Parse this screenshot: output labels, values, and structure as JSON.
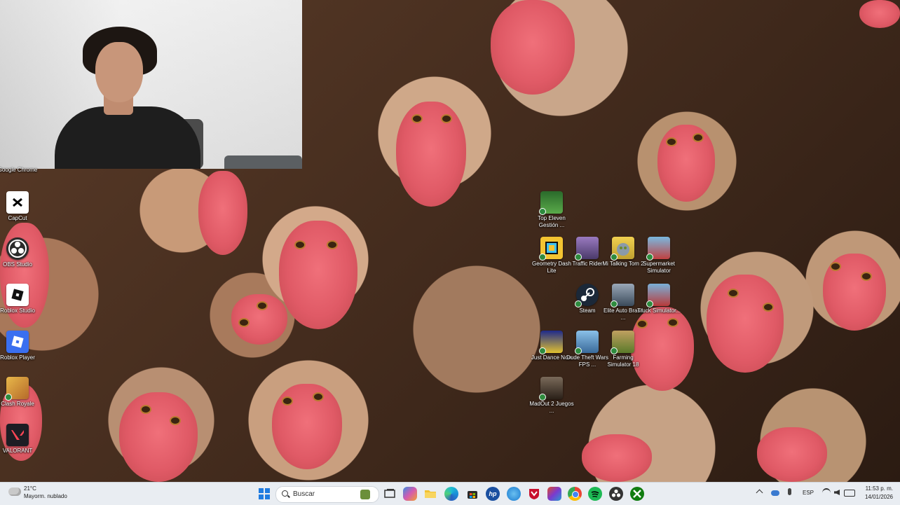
{
  "webcam": {
    "label": ""
  },
  "desktop_left": [
    {
      "label": "Google Chrome",
      "icon": "chrome-icon",
      "color": "#ffffff"
    },
    {
      "label": "CapCut",
      "icon": "capcut-icon",
      "color": "#ffffff"
    },
    {
      "label": "OBS Studio",
      "icon": "obs-icon",
      "color": "#2b2b2b"
    },
    {
      "label": "Roblox Studio",
      "icon": "roblox-studio-icon",
      "color": "#ffffff"
    },
    {
      "label": "Roblox Player",
      "icon": "roblox-player-icon",
      "color": "#3a6ff0"
    },
    {
      "label": "Clash Royale",
      "icon": "clash-royale-icon",
      "color": "#d8a13a"
    },
    {
      "label": "VALORANT",
      "icon": "valorant-icon",
      "color": "#1d1d24"
    }
  ],
  "desktop_games": [
    {
      "label": "Top Eleven Gestión ...",
      "icon": "top-eleven-icon",
      "color": "#3d8f3a"
    },
    {
      "label": "Geometry Dash Lite",
      "icon": "geometry-dash-icon",
      "color": "#f4c431"
    },
    {
      "label": "Traffic Rider",
      "icon": "traffic-rider-icon",
      "color": "#7a5a9a"
    },
    {
      "label": "Mi Talking Tom 2",
      "icon": "talking-tom-icon",
      "color": "#e9c341"
    },
    {
      "label": "Supermarket Simulator",
      "icon": "supermarket-simulator-icon",
      "color": "#5fa4d6"
    },
    {
      "label": "Steam",
      "icon": "steam-icon",
      "color": "#1b2838"
    },
    {
      "label": "Elite Auto Brasil ...",
      "icon": "elite-auto-icon",
      "color": "#6b7a8a"
    },
    {
      "label": "Truck Simulator...",
      "icon": "truck-simulator-icon",
      "color": "#b83a3a"
    },
    {
      "label": "Just Dance Now",
      "icon": "just-dance-icon",
      "color": "#1f2a8a"
    },
    {
      "label": "Dude Theft Wars FPS ...",
      "icon": "dude-theft-wars-icon",
      "color": "#5a9ad0"
    },
    {
      "label": "Farming Simulator 18",
      "icon": "farming-simulator-icon",
      "color": "#8a6a2a"
    },
    {
      "label": "MadOut 2 Juegos ...",
      "icon": "madout-icon",
      "color": "#4a3a2a"
    }
  ],
  "taskbar": {
    "weather_temp": "21°C",
    "weather_desc": "Mayorm. nublado",
    "search_placeholder": "Buscar",
    "apps": [
      {
        "icon": "windows-start-icon",
        "color": "#1e7be0"
      },
      {
        "icon": "widgets-icon",
        "color": "#6b8f3a"
      },
      {
        "icon": "task-view-icon",
        "color": "#3a3a3a"
      },
      {
        "icon": "copilot-icon",
        "color": "#7d5de0"
      },
      {
        "icon": "file-explorer-icon",
        "color": "#f2c230"
      },
      {
        "icon": "edge-icon",
        "color": "#1a8fd8"
      },
      {
        "icon": "store-icon",
        "color": "#2a2a2a"
      },
      {
        "icon": "hp-icon",
        "color": "#1a4fa0"
      },
      {
        "icon": "browser-icon",
        "color": "#2a8ad0"
      },
      {
        "icon": "mcafee-icon",
        "color": "#c8102e"
      },
      {
        "icon": "office-icon",
        "color": "#d04a2a"
      },
      {
        "icon": "chrome-icon",
        "color": "#34a853"
      },
      {
        "icon": "spotify-icon",
        "color": "#1db954"
      },
      {
        "icon": "obs-icon",
        "color": "#333333"
      },
      {
        "icon": "xbox-icon",
        "color": "#107c10"
      }
    ],
    "language": "ESP",
    "time": "11:53 p. m.",
    "date": "14/01/2026"
  }
}
